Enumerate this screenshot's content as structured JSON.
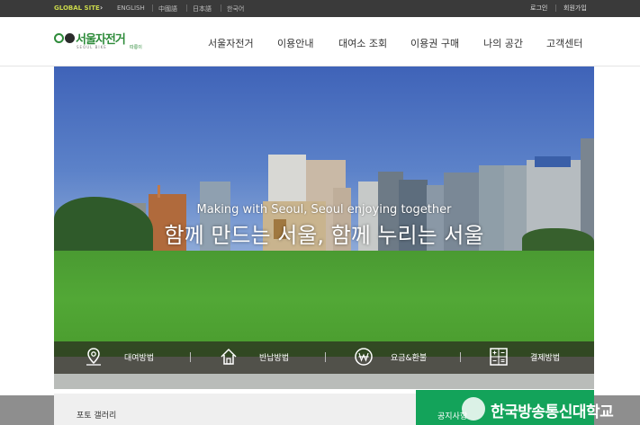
{
  "topbar": {
    "global_site": "GLOBAL SITE",
    "languages": [
      "ENGLISH",
      "中國語",
      "日本語",
      "한국어"
    ],
    "login": "로그인",
    "signup": "회원가입"
  },
  "logo": {
    "name": "서울자전거",
    "sub": "SEOUL BIKE",
    "tag": "따릉이"
  },
  "nav": {
    "items": [
      "서울자전거",
      "이용안내",
      "대여소 조회",
      "이용권 구매",
      "나의 공간",
      "고객센터"
    ]
  },
  "hero": {
    "subtitle": "Making with Seoul, Seoul enjoying together",
    "title": "함께 만드는 서울, 함께 누리는 서울"
  },
  "quick_menu": {
    "items": [
      {
        "label": "대여방법",
        "icon": "location-pin-icon"
      },
      {
        "label": "반납방법",
        "icon": "home-icon"
      },
      {
        "label": "요금&환불",
        "icon": "won-icon"
      },
      {
        "label": "결제방법",
        "icon": "calculator-icon"
      }
    ]
  },
  "bottom": {
    "photo_gallery": "포토 갤러리",
    "notice": "공지사항"
  },
  "watermark": {
    "text": "한국방송통신대학교"
  },
  "colors": {
    "brand_green": "#2e8b3a",
    "notice_green": "#13a35a",
    "topbar_bg": "#3a3a3a"
  }
}
